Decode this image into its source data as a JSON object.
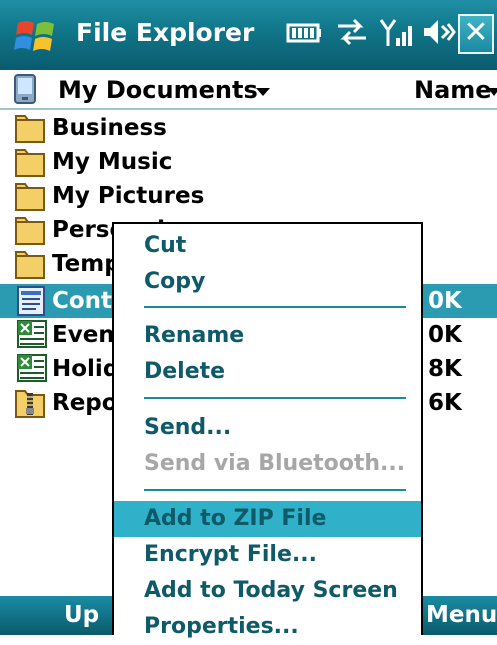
{
  "title_bar": {
    "app_title": "File Explorer",
    "close_label": "✕"
  },
  "location_bar": {
    "folder": "My Documents",
    "sort": "Name"
  },
  "files": [
    {
      "name": "Business",
      "type": "folder",
      "size": ""
    },
    {
      "name": "My Music",
      "type": "folder",
      "size": ""
    },
    {
      "name": "My Pictures",
      "type": "folder",
      "size": ""
    },
    {
      "name": "Personal",
      "type": "folder",
      "size": ""
    },
    {
      "name": "Templates",
      "type": "folder",
      "size": ""
    },
    {
      "name": "Contract",
      "type": "word",
      "size": "0K",
      "selected": true
    },
    {
      "name": "Events",
      "type": "excel",
      "size": "0K"
    },
    {
      "name": "Holiday",
      "type": "excel",
      "size": "8K"
    },
    {
      "name": "Report",
      "type": "zip",
      "size": "6K"
    }
  ],
  "context_menu": {
    "items": [
      {
        "label": "Cut"
      },
      {
        "label": "Copy"
      },
      {
        "label": "Rename"
      },
      {
        "label": "Delete"
      },
      {
        "label": "Send..."
      },
      {
        "label": "Send via Bluetooth...",
        "disabled": true
      },
      {
        "label": "Add to ZIP File",
        "highlighted": true
      },
      {
        "label": "Encrypt File..."
      },
      {
        "label": "Add to Today Screen"
      },
      {
        "label": "Properties..."
      }
    ]
  },
  "soft_keys": {
    "left": "Up",
    "right": "Menu"
  },
  "colors": {
    "title_bar": "#107588",
    "selection": "#2a9bb1",
    "menu_highlight": "#2fb2c9",
    "menu_text": "#0f5a68",
    "disabled_text": "#a7a7a7"
  }
}
